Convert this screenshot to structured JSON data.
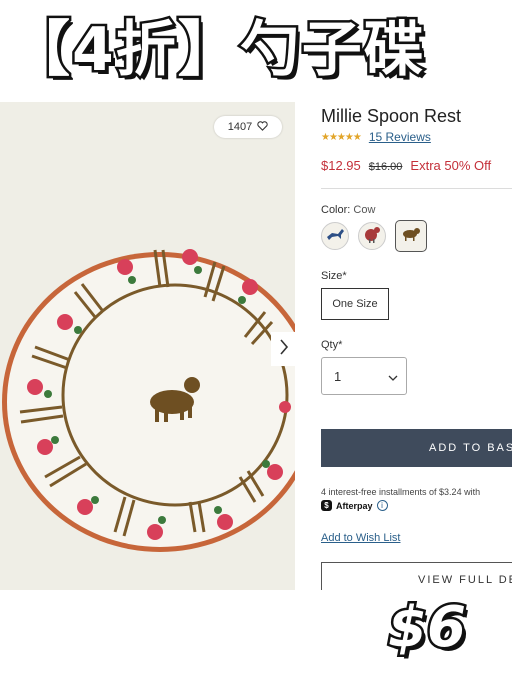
{
  "banner": {
    "title": "【4折】勺子碟"
  },
  "gallery": {
    "likes": "1407",
    "heart_icon": "heart-outline-icon",
    "next_icon": "chevron-right-icon"
  },
  "product": {
    "title": "Millie Spoon Rest",
    "stars": "★★★★★",
    "reviews": "15 Reviews",
    "price": "$12.95",
    "old_price": "$16.00",
    "promo": "Extra 50% Off",
    "color_label": "Color:",
    "color_value": "Cow",
    "swatches": [
      "goat",
      "rooster",
      "cow"
    ],
    "selected_swatch": "cow",
    "size_label": "Size*",
    "size_option": "One Size",
    "qty_label": "Qty*",
    "qty_value": "1",
    "add_to_bag": "ADD TO BAS",
    "installments": "4 interest-free installments of $3.24 with",
    "afterpay": "Afterpay",
    "wishlist": "Add to Wish List",
    "view_full": "VIEW FULL DE"
  },
  "sticker": {
    "price": "$6"
  },
  "colors": {
    "price_red": "#c4303a",
    "link_blue": "#2a5f8a",
    "button_dark": "#3f4b5c",
    "star_gold": "#e2a52a"
  }
}
